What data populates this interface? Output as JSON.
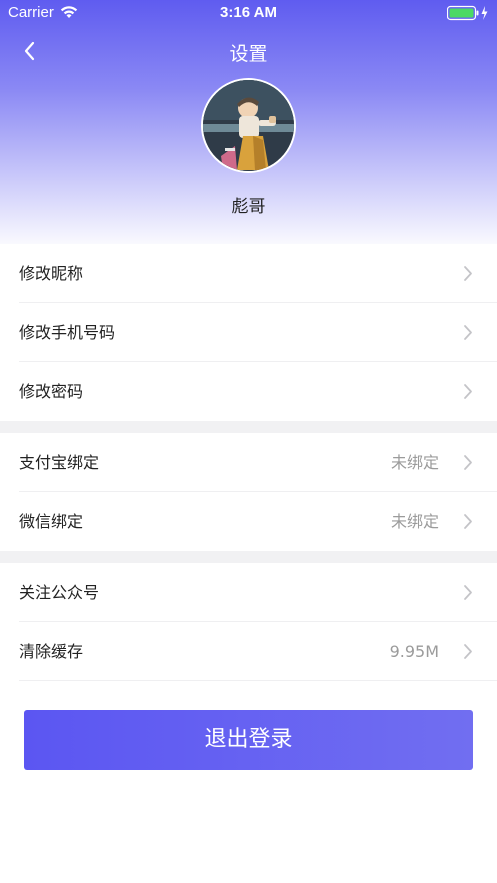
{
  "status_bar": {
    "carrier": "Carrier",
    "time": "3:16 AM"
  },
  "nav": {
    "title": "设置"
  },
  "profile": {
    "username": "彪哥"
  },
  "menu": {
    "group1": [
      {
        "label": "修改昵称"
      },
      {
        "label": "修改手机号码"
      },
      {
        "label": "修改密码"
      }
    ],
    "group2": [
      {
        "label": "支付宝绑定",
        "value": "未绑定"
      },
      {
        "label": "微信绑定",
        "value": "未绑定"
      }
    ],
    "group3": [
      {
        "label": "关注公众号"
      },
      {
        "label": "清除缓存",
        "value": "9.95M"
      }
    ]
  },
  "logout_label": "退出登录",
  "colors": {
    "accent": "#5f5cf0",
    "button": "#625df2",
    "value_text": "#9b9b9b"
  }
}
